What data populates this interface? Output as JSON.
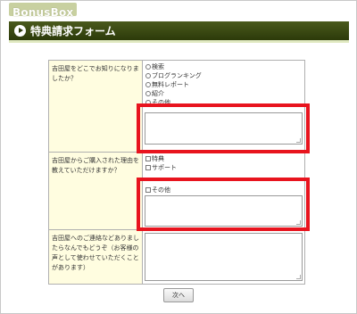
{
  "logo": {
    "text": "BonusBox"
  },
  "header": {
    "title": "特典請求フォーム"
  },
  "form": {
    "q1": {
      "label": "吉田屋をどこでお知りになりましたか？",
      "options": [
        "検索",
        "ブログランキング",
        "無料レポート",
        "紹介",
        "その他"
      ]
    },
    "q2": {
      "label": "吉田屋からご購入された理由を教えていただけますか？",
      "options": [
        "特典",
        "サポート"
      ],
      "other_label": "その他"
    },
    "q3": {
      "label": "吉田屋へのご連絡などありましたらなんでもどうぞ（お客様の声として使わせていただくことがあります）"
    }
  },
  "buttons": {
    "next": "次へ"
  },
  "colors": {
    "highlight": "#e8141e",
    "title_bar": "#2c3a0a",
    "label_bg": "#fffde0"
  }
}
